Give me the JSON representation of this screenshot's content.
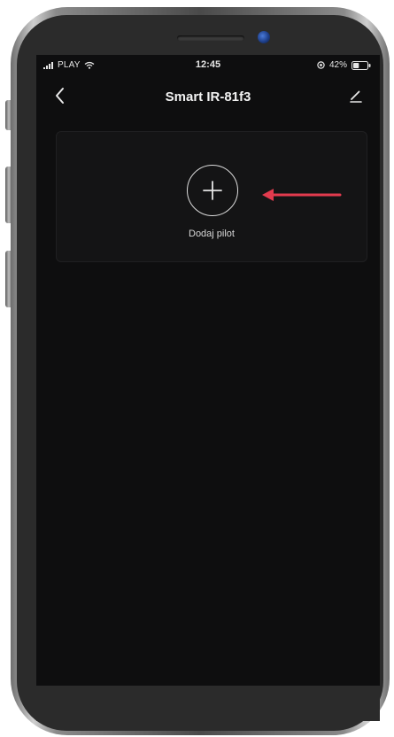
{
  "status_bar": {
    "carrier": "PLAY",
    "time": "12:45",
    "battery_percent": "42%",
    "battery_level": 0.42
  },
  "nav": {
    "title": "Smart IR-81f3",
    "back_icon": "chevron-left-icon",
    "edit_icon": "pencil-icon"
  },
  "add_remote": {
    "label": "Dodaj pilot",
    "icon": "plus-icon"
  },
  "colors": {
    "screen_bg": "#0e0e0f",
    "card_bg": "#141415",
    "annotation_arrow": "#e23b4e"
  }
}
